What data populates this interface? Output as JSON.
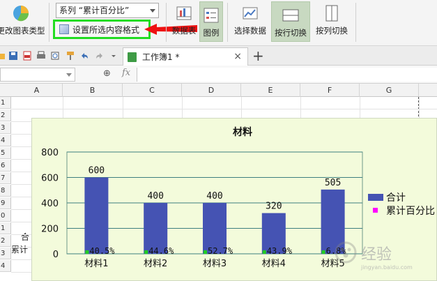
{
  "ribbon": {
    "change_chart_type_label": "更改图表类型",
    "series_select_value": "系列 “累计百分比”",
    "format_selection_label": "设置所选内容格式",
    "data_table_label": "数据表",
    "legend_label": "图例",
    "select_data_label": "选择数据",
    "switch_rows_label": "按行切换",
    "switch_cols_label": "按列切换"
  },
  "tabs": {
    "workbook_label": "工作簿1 *",
    "close_symbol": "×",
    "add_symbol": "+"
  },
  "formula_bar": {
    "zoom_symbol": "⊕",
    "fx_symbol": "fx"
  },
  "columns": [
    "A",
    "B",
    "C",
    "D",
    "E",
    "F",
    "G"
  ],
  "rows": [
    "1",
    "2",
    "3",
    "4",
    "5",
    "6",
    "7",
    "8",
    "9",
    "0",
    "1",
    "2",
    "3",
    "4"
  ],
  "cells": {
    "row11_fragment": "合",
    "row12_fragment": "累计"
  },
  "colors": {
    "bar": "#4553b3",
    "marker": "#ff00ff",
    "pct_marker": "#22cc22",
    "chart_bg": "#f3fbdb",
    "accent_green": "#22dd22",
    "arrow_red": "#ee1111"
  },
  "chart_data": {
    "type": "bar",
    "title": "材料",
    "categories": [
      "材料1",
      "材料2",
      "材料3",
      "材料4",
      "材料5"
    ],
    "series": [
      {
        "name": "合计",
        "values": [
          600,
          400,
          400,
          320,
          505
        ]
      },
      {
        "name": "累计百分比",
        "values": [
          "40.5%",
          "44.6%",
          "52.7%",
          "43.9%",
          "6.8%"
        ]
      }
    ],
    "ylim": [
      0,
      800
    ],
    "yticks": [
      "0",
      "200",
      "400",
      "600",
      "800"
    ],
    "grid": true,
    "legend_position": "right"
  },
  "watermark": {
    "text": "经验",
    "sub": "jingyan.baidu.com"
  }
}
